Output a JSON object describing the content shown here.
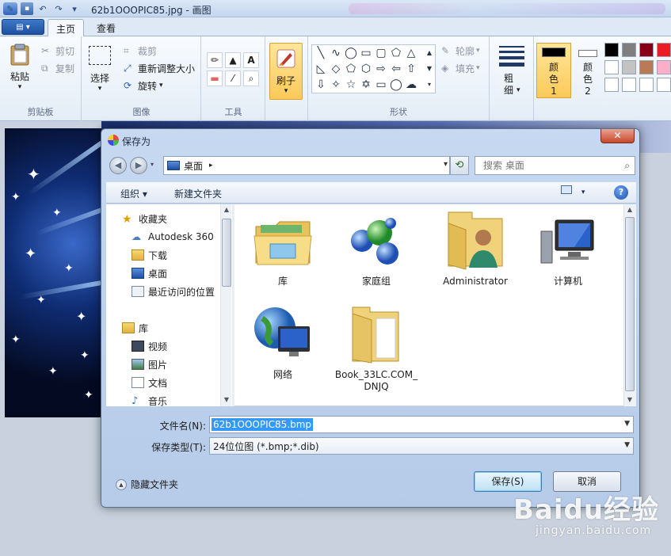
{
  "paint": {
    "title": "62b1OOOPIC85.jpg - 画图",
    "tabs": [
      {
        "label": "主页"
      },
      {
        "label": "查看"
      }
    ],
    "ribbon": {
      "clipboard": {
        "label": "剪贴板",
        "paste": "粘贴",
        "cut": "剪切",
        "copy": "复制"
      },
      "image": {
        "label": "图像",
        "select": "选择",
        "crop": "裁剪",
        "resize": "重新调整大小",
        "rotate": "旋转"
      },
      "tools": {
        "label": "工具"
      },
      "brushes": {
        "label": "刷子"
      },
      "shapes": {
        "label": "形状",
        "outline": "轮廓",
        "fill": "填充"
      },
      "size": {
        "label": "粗细"
      },
      "color1": {
        "label": "颜色 1"
      },
      "color2": {
        "label": "颜色 2"
      }
    },
    "colors": {
      "color1": "#000000",
      "color2": "#ffffff",
      "palette": [
        "#000000",
        "#7f7f7f",
        "#880015",
        "#ed1c24",
        "#ffffff",
        "#c3c3c3",
        "#b97a57",
        "#ffaec9",
        "#ffffff",
        "#ffffff",
        "#ffffff",
        "#ffffff"
      ]
    }
  },
  "dialog": {
    "title": "保存为",
    "address": "桌面",
    "search_placeholder": "搜索 桌面",
    "toolbar": {
      "organize": "组织 ▾",
      "new_folder": "新建文件夹"
    },
    "nav": {
      "favorites": "收藏夹",
      "items": [
        "Autodesk 360",
        "下载",
        "桌面",
        "最近访问的位置"
      ],
      "libraries": "库",
      "lib_items": [
        "视频",
        "图片",
        "文档",
        "音乐"
      ]
    },
    "files": [
      {
        "name": "库"
      },
      {
        "name": "家庭组"
      },
      {
        "name": "Administrator"
      },
      {
        "name": "计算机"
      },
      {
        "name": "网络"
      },
      {
        "name": "Book_33LC.COM_DNJQ"
      }
    ],
    "filename_label": "文件名(N):",
    "filename": "62b1OOOPIC85.bmp",
    "filetype_label": "保存类型(T):",
    "filetype": "24位位图 (*.bmp;*.dib)",
    "hide_folders": "隐藏文件夹",
    "save_button": "保存(S)",
    "cancel_button": "取消"
  },
  "watermark": {
    "brand": "Baidu经验",
    "sub": "jingyan.baidu.com"
  }
}
